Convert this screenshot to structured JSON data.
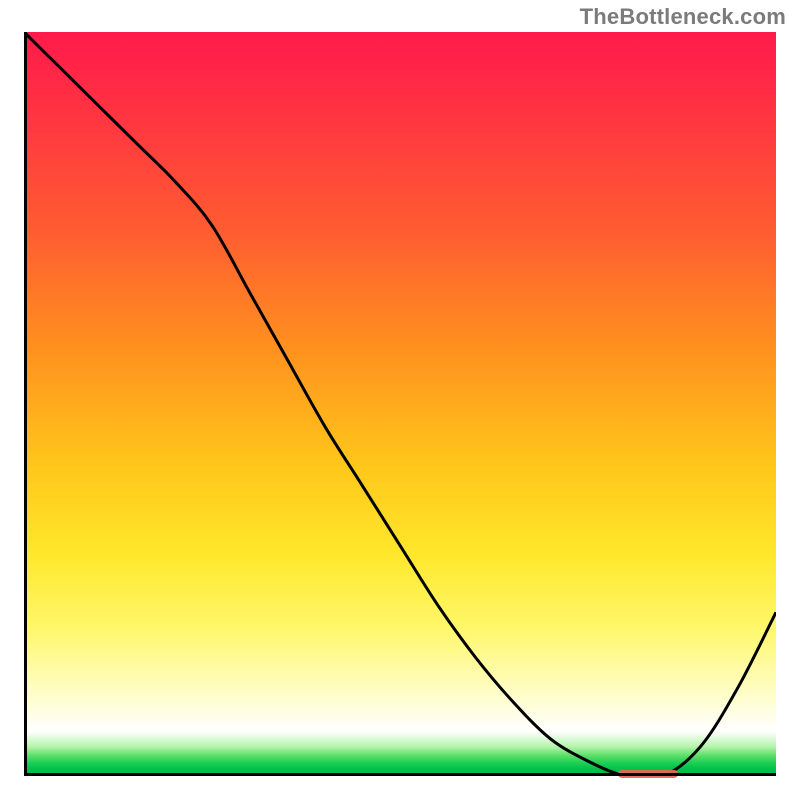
{
  "attribution": "TheBottleneck.com",
  "colors": {
    "curve": "#000000",
    "marker": "#e36a5a",
    "gradient_top": "#ff1a4b",
    "gradient_bottom": "#00b846"
  },
  "chart_data": {
    "type": "line",
    "title": "",
    "xlabel": "",
    "ylabel": "",
    "xlim": [
      0,
      100
    ],
    "ylim": [
      0,
      100
    ],
    "x": [
      0,
      5,
      10,
      15,
      20,
      25,
      30,
      35,
      40,
      45,
      50,
      55,
      60,
      65,
      70,
      75,
      80,
      85,
      90,
      95,
      100
    ],
    "values": [
      100,
      95,
      90,
      85,
      80,
      74,
      65,
      56,
      47,
      39,
      31,
      23,
      16,
      10,
      5,
      2,
      0,
      0,
      4,
      12,
      22
    ],
    "optimal_range_x": [
      79,
      87
    ],
    "marker_y": 0.3,
    "legend": false,
    "grid": false,
    "annotations": []
  }
}
